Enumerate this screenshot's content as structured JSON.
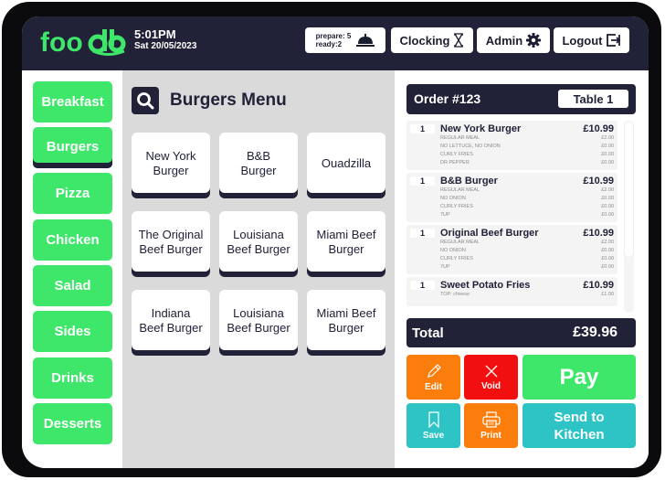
{
  "app": {
    "brand": "foodb",
    "brand_color": "#3ee66a",
    "dark_color": "#212238"
  },
  "header": {
    "time": "5:01PM",
    "date": "Sat 20/05/2023",
    "orders_status": {
      "prepare": "prepare: 5",
      "ready": "ready:2",
      "icon": "service-bell-icon"
    },
    "buttons": [
      {
        "label": "Clocking",
        "icon": "hourglass-icon"
      },
      {
        "label": "Admin",
        "icon": "gear-icon"
      },
      {
        "label": "Logout",
        "icon": "logout-icon"
      }
    ]
  },
  "categories": [
    {
      "label": "Breakfast",
      "active": false
    },
    {
      "label": "Burgers",
      "active": true
    },
    {
      "label": "Pizza",
      "active": false
    },
    {
      "label": "Chicken",
      "active": false
    },
    {
      "label": "Salad",
      "active": false
    },
    {
      "label": "Sides",
      "active": false
    },
    {
      "label": "Drinks",
      "active": false
    },
    {
      "label": "Desserts",
      "active": false
    }
  ],
  "menu": {
    "title": "Burgers Menu",
    "items": [
      {
        "line1": "New York",
        "line2": "Burger"
      },
      {
        "line1": "B&B",
        "line2": "Burger"
      },
      {
        "line1": "Ouadzilla",
        "line2": ""
      },
      {
        "line1": "The Original",
        "line2": "Beef Burger"
      },
      {
        "line1": "Louisiana",
        "line2": "Beef Burger"
      },
      {
        "line1": "Miami Beef",
        "line2": "Burger"
      },
      {
        "line1": "Indiana",
        "line2": "Beef Burger"
      },
      {
        "line1": "Louisiana",
        "line2": "Beef Burger"
      },
      {
        "line1": "Miami Beef",
        "line2": "Burger"
      }
    ]
  },
  "order": {
    "number": "Order #123",
    "table": "Table 1",
    "lines": [
      {
        "qty": "1",
        "name": "New York Burger",
        "price": "£10.99",
        "mods": [
          {
            "label": "REGULAR MEAL",
            "price": "£2.00"
          },
          {
            "label": "NO LETTUCE, NO ONION",
            "price": "£0.00"
          },
          {
            "label": "CURLY FRIES",
            "price": "£0.00"
          },
          {
            "label": "DR PEPPER",
            "price": "£0.00"
          }
        ]
      },
      {
        "qty": "1",
        "name": "B&B Burger",
        "price": "£10.99",
        "mods": [
          {
            "label": "REGULAR MEAL",
            "price": "£2.00"
          },
          {
            "label": "NO ONION",
            "price": "£0.00"
          },
          {
            "label": "CURLY FRIES",
            "price": "£0.00"
          },
          {
            "label": "7UP",
            "price": "£0.00"
          }
        ]
      },
      {
        "qty": "1",
        "name": "Original Beef Burger",
        "price": "£10.99",
        "mods": [
          {
            "label": "REGULAR MEAL",
            "price": "£2.00"
          },
          {
            "label": "NO ONION",
            "price": "£0.00"
          },
          {
            "label": "CURLY FRIES",
            "price": "£0.00"
          },
          {
            "label": "7UP",
            "price": "£0.00"
          }
        ]
      },
      {
        "qty": "1",
        "name": "Sweet Potato Fries",
        "price": "£10.99",
        "mods": [
          {
            "label": "TOP: cheese",
            "price": "£1.00"
          }
        ]
      }
    ],
    "total_label": "Total",
    "total": "£39.96"
  },
  "actions": {
    "edit": "Edit",
    "void": "Void",
    "pay": "Pay",
    "save": "Save",
    "print": "Print",
    "send_line1": "Send to",
    "send_line2": "Kitchen",
    "colors": {
      "edit": "#fb7d0b",
      "void": "#f20f0f",
      "pay": "#3ee66a",
      "save": "#2ec4c6",
      "print": "#fb7d0b",
      "send": "#2ec4c6"
    }
  }
}
